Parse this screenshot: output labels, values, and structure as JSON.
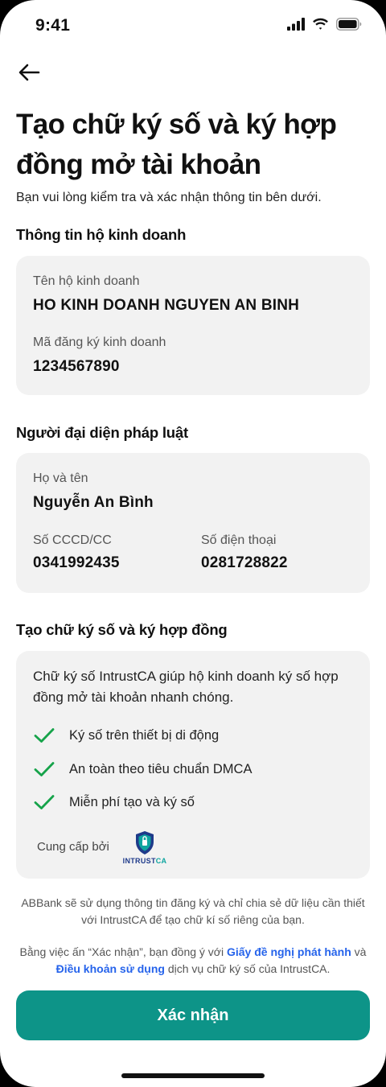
{
  "status_bar": {
    "time": "9:41"
  },
  "header": {
    "back_icon": "arrow-left-icon",
    "title": "Tạo chữ ký số và ký hợp đồng mở tài khoản",
    "subtitle": "Bạn vui lòng kiểm tra và xác nhận thông tin bên dưới."
  },
  "business": {
    "section_title": "Thông tin hộ kinh doanh",
    "name_label": "Tên hộ kinh doanh",
    "name_value": "HO KINH DOANH NGUYEN AN BINH",
    "reg_label": "Mã đăng ký kinh doanh",
    "reg_value": "1234567890"
  },
  "representative": {
    "section_title": "Người đại diện pháp luật",
    "fullname_label": "Họ và tên",
    "fullname_value": "Nguyễn An Bình",
    "id_label": "Số CCCD/CC",
    "id_value": "0341992435",
    "phone_label": "Số điện thoại",
    "phone_value": "0281728822"
  },
  "signature": {
    "section_title": "Tạo chữ ký số và ký hợp đồng",
    "description": "Chữ ký số IntrustCA giúp hộ kinh doanh ký số hợp đồng mở tài khoản nhanh chóng.",
    "features": [
      "Ký số trên thiết bị di động",
      "An toàn theo tiêu chuẩn DMCA",
      "Miễn phí tạo và ký số"
    ],
    "provider_label": "Cung cấp bởi",
    "logo_text_main": "INTRUST",
    "logo_text_ca": "CA"
  },
  "notes": {
    "privacy": "ABBank sẽ sử dụng thông tin đăng ký và chỉ chia sẻ dữ liệu cần thiết với IntrustCA để tạo chữ kí số riêng của bạn.",
    "consent_prefix": "Bằng việc ấn “Xác nhận”, bạn đồng ý với ",
    "consent_link1": "Giấy đề nghị phát hành",
    "consent_and": " và ",
    "consent_link2": "Điều khoản sử dụng",
    "consent_suffix": " dịch vụ chữ ký số của IntrustCA."
  },
  "actions": {
    "confirm_label": "Xác nhận"
  },
  "colors": {
    "primary": "#0d9488",
    "check": "#16a34a",
    "link": "#2563eb",
    "card_bg": "#f2f2f2"
  }
}
